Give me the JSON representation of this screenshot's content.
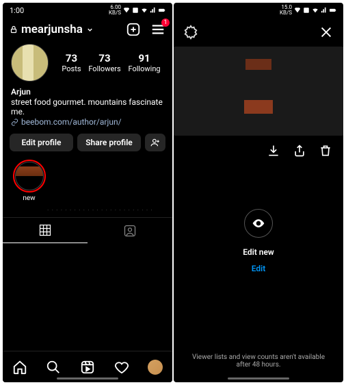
{
  "left": {
    "status": {
      "time": "1:00",
      "net": "6.00\nKB/S"
    },
    "header": {
      "username": "mearjunsha",
      "badge": "1"
    },
    "stats": {
      "posts_num": "73",
      "posts_label": "Posts",
      "followers_num": "73",
      "followers_label": "Followers",
      "following_num": "91",
      "following_label": "Following"
    },
    "bio": {
      "name": "Arjun",
      "text": "street food gourmet. mountains fascinate me.",
      "link": "beebom.com/author/arjun/"
    },
    "buttons": {
      "edit": "Edit profile",
      "share": "Share profile"
    },
    "highlight": {
      "label": "new"
    }
  },
  "right": {
    "status": {
      "net": "15.0\nKB/S"
    },
    "center": {
      "title": "Edit new",
      "action": "Edit"
    },
    "footer": "Viewer lists and view counts aren't available after 48 hours."
  }
}
